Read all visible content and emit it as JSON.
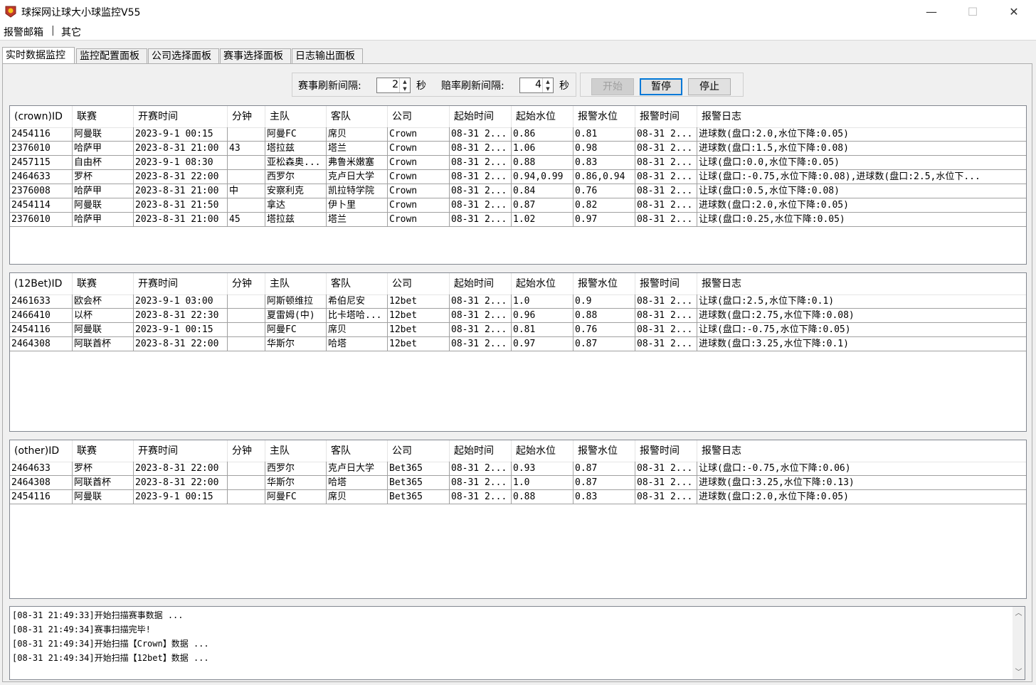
{
  "window": {
    "title": "球探网让球大小球监控V55",
    "minimize": "—",
    "maximize": "☐",
    "close": "✕"
  },
  "menu": [
    "报警邮箱",
    "|",
    "其它"
  ],
  "tabs": [
    {
      "label": "实时数据监控",
      "active": true
    },
    {
      "label": "监控配置面板",
      "active": false
    },
    {
      "label": "公司选择面板",
      "active": false
    },
    {
      "label": "赛事选择面板",
      "active": false
    },
    {
      "label": "日志输出面板",
      "active": false
    }
  ],
  "controls": {
    "match_refresh_label": "赛事刷新间隔:",
    "match_refresh_value": "2",
    "match_refresh_unit": "秒",
    "odds_refresh_label": "赔率刷新间隔:",
    "odds_refresh_value": "4",
    "odds_refresh_unit": "秒",
    "start_label": "开始",
    "pause_label": "暂停",
    "stop_label": "停止"
  },
  "grids": [
    {
      "columns": [
        "(crown)ID",
        "联赛",
        "开赛时间",
        "分钟",
        "主队",
        "客队",
        "公司",
        "起始时间",
        "起始水位",
        "报警水位",
        "报警时间",
        "报警日志"
      ],
      "rows": [
        [
          "2454116",
          "阿曼联",
          "2023-9-1 00:15",
          "",
          "阿曼FC",
          "席贝",
          "Crown",
          "08-31 2...",
          "0.86",
          "0.81",
          "08-31 2...",
          "进球数(盘口:2.0,水位下降:0.05)"
        ],
        [
          "2376010",
          "哈萨甲",
          "2023-8-31 21:00",
          "43",
          "塔拉兹",
          "塔兰",
          "Crown",
          "08-31 2...",
          "1.06",
          "0.98",
          "08-31 2...",
          "进球数(盘口:1.5,水位下降:0.08)"
        ],
        [
          "2457115",
          "自由杯",
          "2023-9-1 08:30",
          "",
          "亚松森奥...",
          "弗鲁米嫩塞",
          "Crown",
          "08-31 2...",
          "0.88",
          "0.83",
          "08-31 2...",
          "让球(盘口:0.0,水位下降:0.05)"
        ],
        [
          "2464633",
          "罗杯",
          "2023-8-31 22:00",
          "",
          "西罗尔",
          "克卢日大学",
          "Crown",
          "08-31 2...",
          "0.94,0.99",
          "0.86,0.94",
          "08-31 2...",
          "让球(盘口:-0.75,水位下降:0.08),进球数(盘口:2.5,水位下..."
        ],
        [
          "2376008",
          "哈萨甲",
          "2023-8-31 21:00",
          "中",
          "安察利克",
          "凯拉特学院",
          "Crown",
          "08-31 2...",
          "0.84",
          "0.76",
          "08-31 2...",
          "让球(盘口:0.5,水位下降:0.08)"
        ],
        [
          "2454114",
          "阿曼联",
          "2023-8-31 21:50",
          "",
          "拿达",
          "伊卜里",
          "Crown",
          "08-31 2...",
          "0.87",
          "0.82",
          "08-31 2...",
          "进球数(盘口:2.0,水位下降:0.05)"
        ],
        [
          "2376010",
          "哈萨甲",
          "2023-8-31 21:00",
          "45",
          "塔拉兹",
          "塔兰",
          "Crown",
          "08-31 2...",
          "1.02",
          "0.97",
          "08-31 2...",
          "让球(盘口:0.25,水位下降:0.05)"
        ]
      ]
    },
    {
      "columns": [
        "(12Bet)ID",
        "联赛",
        "开赛时间",
        "分钟",
        "主队",
        "客队",
        "公司",
        "起始时间",
        "起始水位",
        "报警水位",
        "报警时间",
        "报警日志"
      ],
      "rows": [
        [
          "2461633",
          "欧会杯",
          "2023-9-1 03:00",
          "",
          "阿斯顿维拉",
          "希伯尼安",
          "12bet",
          "08-31 2...",
          "1.0",
          "0.9",
          "08-31 2...",
          "让球(盘口:2.5,水位下降:0.1)"
        ],
        [
          "2466410",
          "以杯",
          "2023-8-31 22:30",
          "",
          "夏雷姆(中)",
          "比卡塔哈...",
          "12bet",
          "08-31 2...",
          "0.96",
          "0.88",
          "08-31 2...",
          "进球数(盘口:2.75,水位下降:0.08)"
        ],
        [
          "2454116",
          "阿曼联",
          "2023-9-1 00:15",
          "",
          "阿曼FC",
          "席贝",
          "12bet",
          "08-31 2...",
          "0.81",
          "0.76",
          "08-31 2...",
          "让球(盘口:-0.75,水位下降:0.05)"
        ],
        [
          "2464308",
          "阿联酋杯",
          "2023-8-31 22:00",
          "",
          "华斯尔",
          "哈塔",
          "12bet",
          "08-31 2...",
          "0.97",
          "0.87",
          "08-31 2...",
          "进球数(盘口:3.25,水位下降:0.1)"
        ]
      ]
    },
    {
      "columns": [
        "(other)ID",
        "联赛",
        "开赛时间",
        "分钟",
        "主队",
        "客队",
        "公司",
        "起始时间",
        "起始水位",
        "报警水位",
        "报警时间",
        "报警日志"
      ],
      "rows": [
        [
          "2464633",
          "罗杯",
          "2023-8-31 22:00",
          "",
          "西罗尔",
          "克卢日大学",
          "Bet365",
          "08-31 2...",
          "0.93",
          "0.87",
          "08-31 2...",
          "让球(盘口:-0.75,水位下降:0.06)"
        ],
        [
          "2464308",
          "阿联酋杯",
          "2023-8-31 22:00",
          "",
          "华斯尔",
          "哈塔",
          "Bet365",
          "08-31 2...",
          "1.0",
          "0.87",
          "08-31 2...",
          "进球数(盘口:3.25,水位下降:0.13)"
        ],
        [
          "2454116",
          "阿曼联",
          "2023-9-1 00:15",
          "",
          "阿曼FC",
          "席贝",
          "Bet365",
          "08-31 2...",
          "0.88",
          "0.83",
          "08-31 2...",
          "进球数(盘口:2.0,水位下降:0.05)"
        ]
      ]
    }
  ],
  "log": [
    "[08-31 21:49:33]开始扫描赛事数据 ...",
    "[08-31 21:49:34]赛事扫描完毕!",
    "[08-31 21:49:34]开始扫描【Crown】数据 ...",
    "[08-31 21:49:34]开始扫描【12bet】数据 ..."
  ]
}
